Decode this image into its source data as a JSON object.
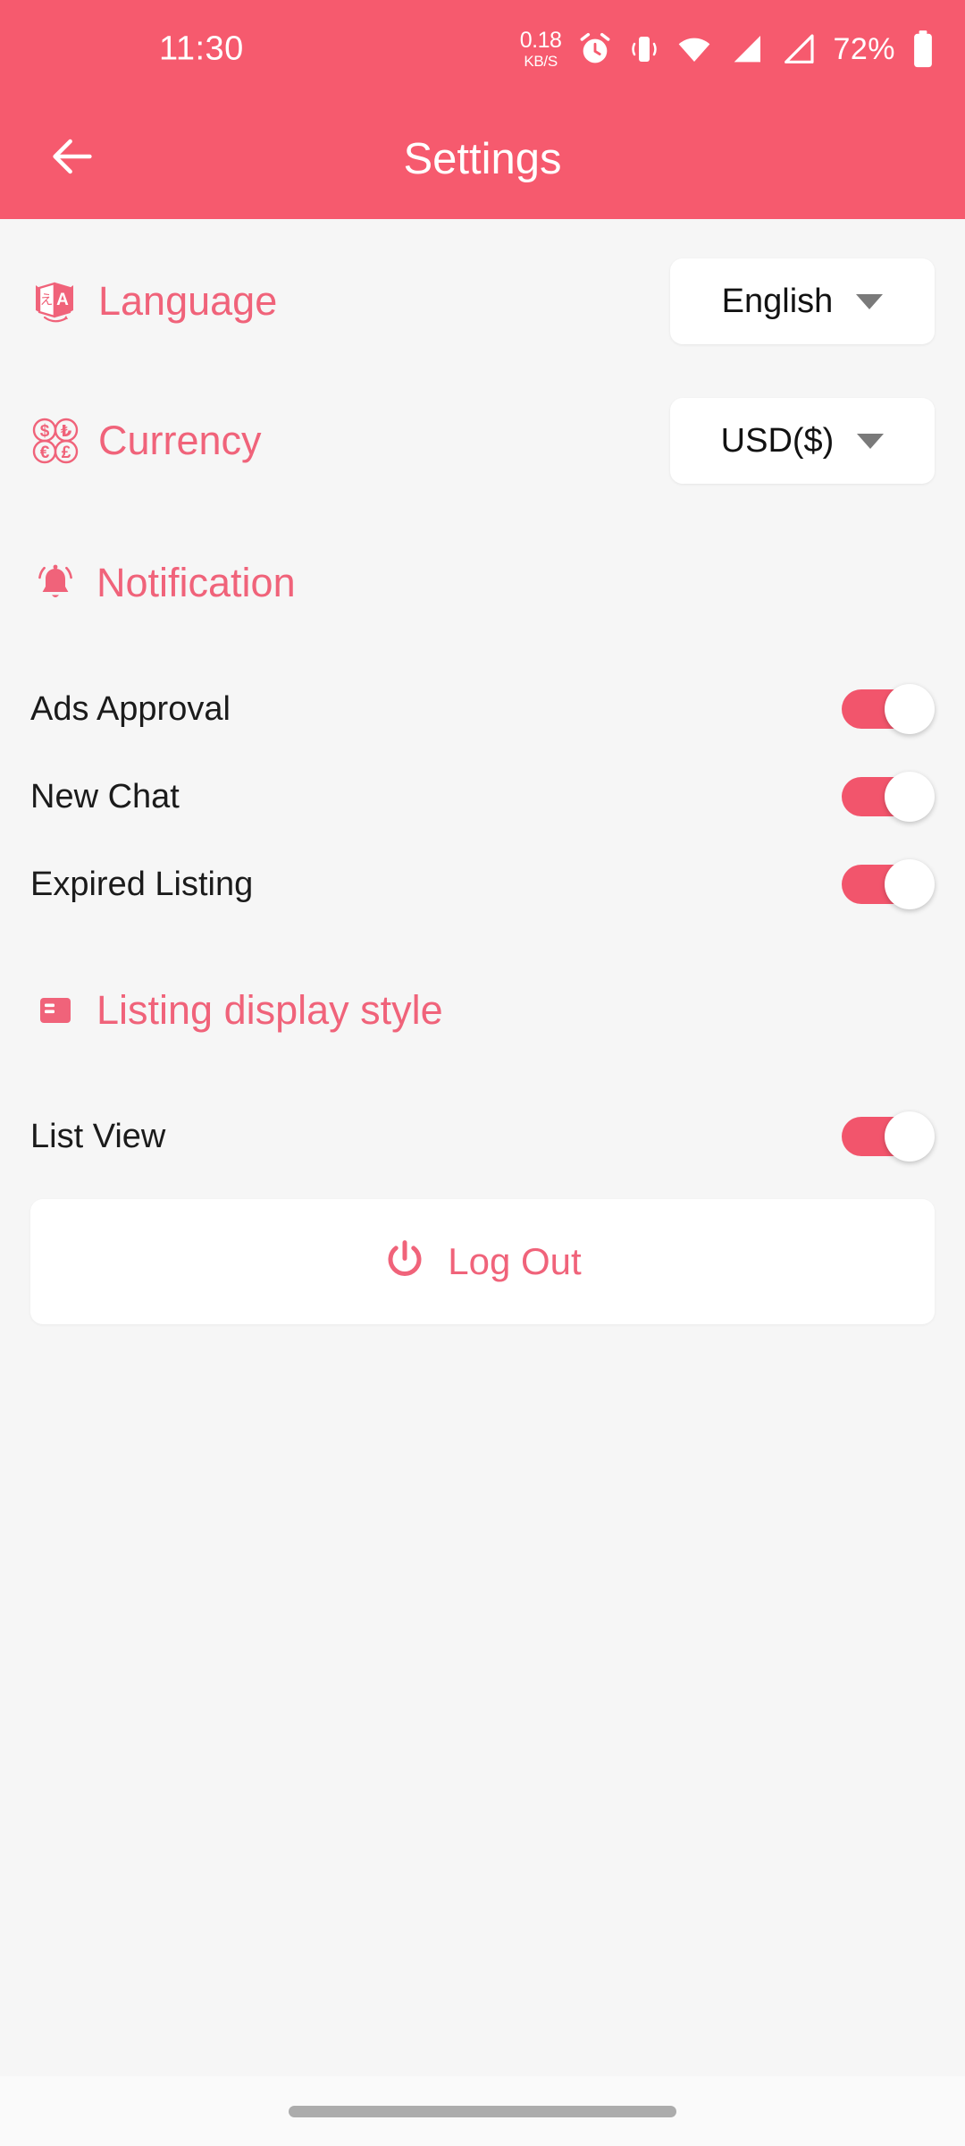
{
  "theme": {
    "primary": "#F65A6E",
    "accent_text": "#F0637A",
    "background": "#F6F6F6",
    "card": "#FFFFFF",
    "switch_on": "#F2556C"
  },
  "status_bar": {
    "time": "11:30",
    "net_speed_value": "0.18",
    "net_speed_unit": "KB/S",
    "icons": [
      "alarm-icon",
      "vibrate-icon",
      "wifi-icon",
      "signal-icon",
      "signal-icon"
    ],
    "battery_percent": "72%"
  },
  "app_bar": {
    "back_icon": "arrow-left-icon",
    "title": "Settings"
  },
  "rows": {
    "language": {
      "icon": "translate-icon",
      "label": "Language",
      "value": "English",
      "caret": "chevron-down-icon"
    },
    "currency": {
      "icon": "currency-coins-icon",
      "label": "Currency",
      "value": "USD($)",
      "caret": "chevron-down-icon"
    }
  },
  "notification": {
    "icon": "bell-icon",
    "title": "Notification",
    "toggles": [
      {
        "label": "Ads Approval",
        "on": true
      },
      {
        "label": "New Chat",
        "on": true
      },
      {
        "label": "Expired Listing",
        "on": true
      }
    ]
  },
  "listing_display": {
    "icon": "listing-style-icon",
    "title": "Listing display style",
    "toggles": [
      {
        "label": "List View",
        "on": true
      }
    ]
  },
  "logout": {
    "icon": "power-icon",
    "label": "Log Out"
  },
  "nav": {
    "gesture_bar": "home-indicator"
  }
}
